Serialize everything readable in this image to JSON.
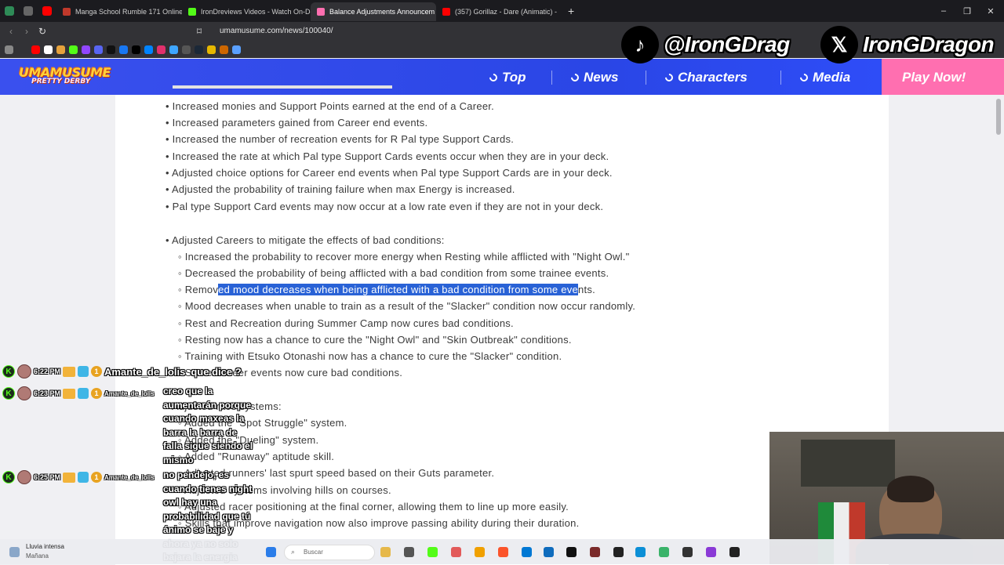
{
  "browser": {
    "tabs": [
      {
        "label": "Manga School Rumble 171 Online -",
        "fav_color": "#c0392b"
      },
      {
        "label": "IronDreviews Videos - Watch On-De",
        "fav_color": "#53fc18"
      },
      {
        "label": "Balance Adjustments Announcem",
        "fav_color": "#ff6fb0"
      },
      {
        "label": "(357) Gorillaz - Dare (Animatic) -",
        "fav_color": "#ff0000"
      }
    ],
    "new_tab": "+",
    "close_tab": "×",
    "url": "umamusume.com/news/100040/",
    "win_min": "–",
    "win_max": "❐",
    "win_close": "✕"
  },
  "site": {
    "logo_line1": "UMAMUSUME",
    "logo_line2": "PRETTY DERBY",
    "nav": [
      "Top",
      "News",
      "Characters",
      "Media"
    ],
    "cta": "Play Now!"
  },
  "article": {
    "lines": [
      "• Increased monies and Support Points earned at the end of a Career.",
      "• Increased parameters gained from Career end events.",
      "• Increased the number of recreation events for R Pal type Support Cards.",
      "• Increased the rate at which Pal type Support Cards events occur when they are in your deck.",
      "• Adjusted choice options for Career end events when Pal type Support Cards are in your deck.",
      "• Adjusted the probability of training failure when max Energy is increased.",
      "• Pal type Support Card events may now occur at a low rate even if they are not in your deck.",
      "• Adjusted Careers to mitigate the effects of bad conditions:",
      "◦ Increased the probability to recover more energy when Resting while afflicted with \"Night Owl.\"",
      "◦ Decreased the probability of being afflicted with a bad condition from some trainee events.",
      "◦ Mood decreases when unable to train as a result of the \"Slacker\" condition now occur randomly.",
      "◦ Rest and Recreation during Summer Camp now cures bad conditions.",
      "◦ Resting now has a chance to cure the \"Night Owl\" and \"Skin Outbreak\" conditions.",
      "◦ Training with Etsuko Otonashi now has a chance to cure the \"Slacker\" condition.",
      "◦ Some Career events now cure bad conditions.",
      "• Adjusted race systems:",
      "◦ Added the \"Spot Struggle\" system.",
      "◦ Added the \"Dueling\" system.",
      "◦ Added \"Runaway\" aptitude skill.",
      "◦ Adjusted runners' last spurt speed based on their Guts parameter.",
      "◦ Adjusted systems involving hills on courses.",
      "◦ Adjusted racer positioning at the final corner, allowing them to line up more easily.",
      "◦ Skills that improve navigation now also improve passing ability during their duration."
    ],
    "highlight_line": {
      "before": "◦ Remov",
      "selected": "ed mood decreases when being afflicted with a bad condition from some eve",
      "after": "nts."
    }
  },
  "overlay": {
    "tiktok_handle": "@IronGDrag",
    "x_handle": "IronGDragon",
    "tiktok_glyph": "♪",
    "x_glyph": "𝕏",
    "chat": [
      {
        "time": "6:22 PM",
        "user": "Amante_de_lolis",
        "message": "que dice ?"
      },
      {
        "time": "6:23 PM",
        "user": "Amante_de_lolis",
        "message": "creo que la aumentarán porque cuando maxeas la barra la barra de falla sigue siendo el mismo"
      },
      {
        "time": "6:25 PM",
        "user": "Amante_de_lolis",
        "message": "no pendejo, es cuando tienes night owl hay una probabilidad que tú ánimo se baje y ahora ya no solo bajara la energia"
      }
    ],
    "chat_badge": "K",
    "chat_level": "1"
  },
  "taskbar": {
    "weather_title": "Lluvia intensa",
    "weather_sub": "Mañana",
    "search_placeholder": "Buscar"
  }
}
